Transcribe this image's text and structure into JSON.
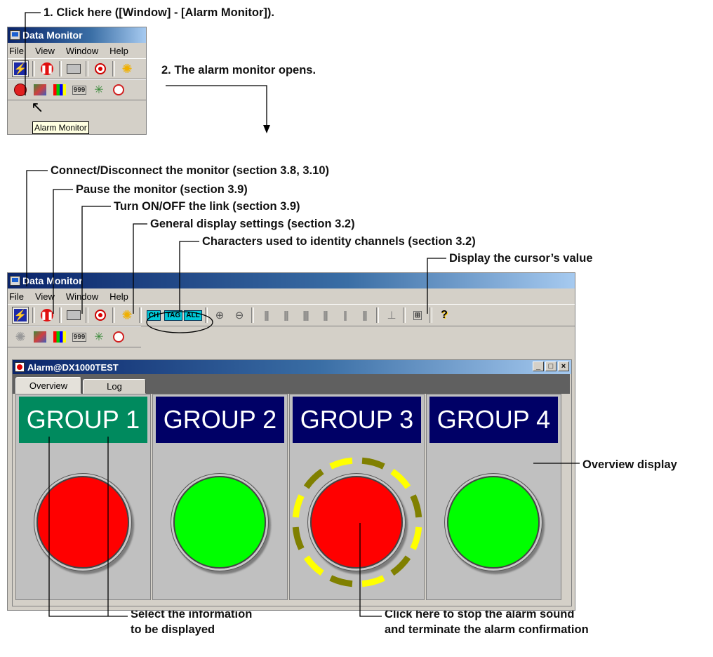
{
  "annotations": {
    "step1": "1. Click here ([Window] - [Alarm Monitor]).",
    "step2": "2. The alarm monitor opens.",
    "connect": "Connect/Disconnect the monitor (section 3.8, 3.10)",
    "pause": "Pause the monitor (section 3.9)",
    "link": "Turn ON/OFF the link (section 3.9)",
    "general": "General display settings (section 3.2)",
    "characters": "Characters used to identity channels (section 3.2)",
    "cursor_value": "Display the cursor’s value",
    "overview_display": "Overview display",
    "select_info_line1": "Select the information",
    "select_info_line2": "to be displayed",
    "stop_alarm_line1": "Click here to stop the alarm sound",
    "stop_alarm_line2": "and terminate the alarm confirmation"
  },
  "small_window": {
    "title": "Data Monitor",
    "menu": [
      "File",
      "View",
      "Window",
      "Help"
    ],
    "tooltip": "Alarm Monitor"
  },
  "main_window": {
    "title": "Data Monitor",
    "menu": [
      "File",
      "View",
      "Window",
      "Help"
    ],
    "channel_buttons": [
      "CH",
      "TAG",
      "ALL"
    ],
    "help_icon": "?"
  },
  "alarm_window": {
    "title": "Alarm@DX1000TEST",
    "window_buttons": [
      "_",
      "□",
      "×"
    ],
    "tabs": [
      "Overview",
      "Log"
    ],
    "groups": [
      {
        "label": "GROUP 1",
        "header_color": "#008a5e",
        "lamp": "red",
        "alarm_active": false
      },
      {
        "label": "GROUP 2",
        "header_color": "#000066",
        "lamp": "green",
        "alarm_active": false
      },
      {
        "label": "GROUP 3",
        "header_color": "#000066",
        "lamp": "red",
        "alarm_active": true
      },
      {
        "label": "GROUP 4",
        "header_color": "#000066",
        "lamp": "green",
        "alarm_active": false
      }
    ]
  },
  "colors": {
    "lamp_red": "#ff0000",
    "lamp_green": "#00ff00",
    "blink_yellow": "#ffff00",
    "blink_olive": "#808000"
  }
}
